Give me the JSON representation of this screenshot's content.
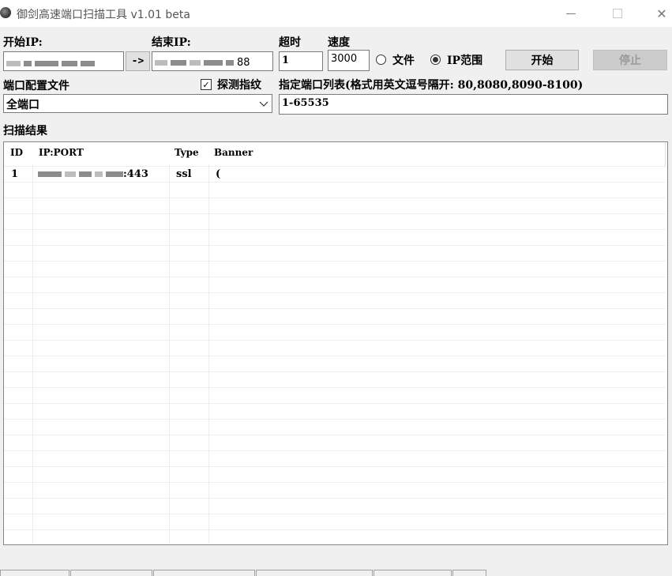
{
  "window": {
    "title": "御剑高速端口扫描工具 v1.01 beta",
    "minimize_glyph": "—",
    "close_glyph": "✕"
  },
  "scan": {
    "start_ip_label": "开始IP:",
    "arrow_button": "->",
    "end_ip_label": "结束IP:",
    "end_ip_tail": "88",
    "timeout_label": "超时",
    "timeout_value": "1",
    "speed_label": "速度",
    "speed_value": "3000",
    "mode_file_label": "文件",
    "mode_range_label": "IP范围",
    "selected_mode": "IP范围",
    "start_button": "开始",
    "stop_button": "停止"
  },
  "ports": {
    "config_label": "端口配置文件",
    "probe_label": "探测指纹",
    "probe_checked": true,
    "config_selected": "全端口",
    "list_label": "指定端口列表(格式用英文逗号隔开: 80,8080,8090-8100)",
    "list_value": "1-65535"
  },
  "results": {
    "label": "扫描结果",
    "columns": [
      "ID",
      "IP:PORT",
      "Type",
      "Banner"
    ],
    "rows": [
      {
        "id": "1",
        "ip_port_tail": ":443",
        "type": "ssl",
        "banner": "("
      }
    ]
  },
  "icons": {
    "app": "app-logo-icon",
    "dropdown": "chevron-down-icon",
    "check": "checkmark-icon"
  }
}
